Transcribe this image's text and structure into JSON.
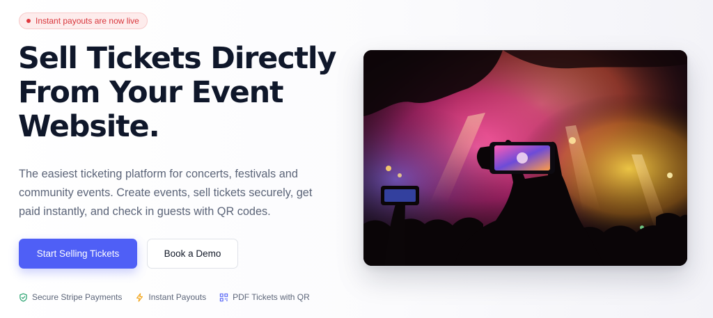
{
  "badge": {
    "text": "Instant payouts are now live"
  },
  "hero": {
    "title": "Sell Tickets Directly From Your Event Website.",
    "subtitle": "The easiest ticketing platform for concerts, festivals and community events. Create events, sell tickets securely, get paid instantly, and check in guests with QR codes."
  },
  "buttons": {
    "primary_label": "Start Selling Tickets",
    "secondary_label": "Book a Demo"
  },
  "features": [
    {
      "label": "Secure Stripe Payments",
      "icon": "shield-check-icon",
      "color": "#22a06b"
    },
    {
      "label": "Instant Payouts",
      "icon": "lightning-icon",
      "color": "#f2a51a"
    },
    {
      "label": "PDF Tickets with QR",
      "icon": "qr-code-icon",
      "color": "#4f5ff6"
    }
  ],
  "image": {
    "subject": "concert-crowd-phone-photo"
  },
  "colors": {
    "accent": "#4f5ff6",
    "heading": "#0f172a",
    "badge_text": "#d8353b"
  }
}
